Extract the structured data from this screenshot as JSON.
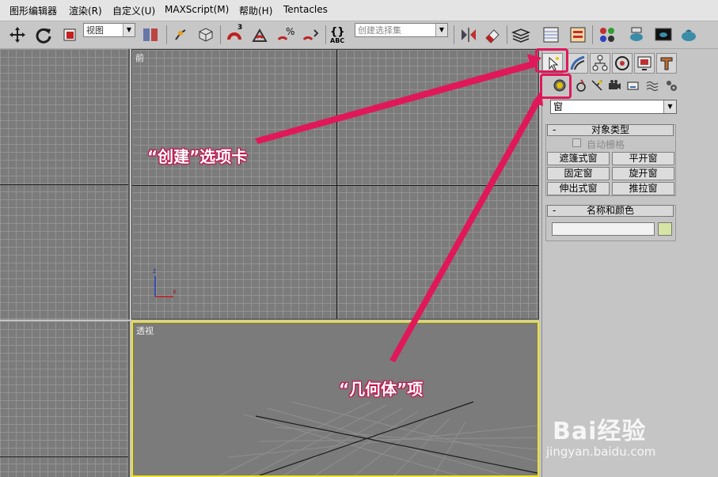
{
  "menu": [
    "图形编辑器",
    "渲染(R)",
    "自定义(U)",
    "MAXScript(M)",
    "帮助(H)",
    "Tentacles"
  ],
  "toolbar": {
    "view_combo": "视图",
    "selection_set_placeholder": "创建选择集",
    "snap_label": "3",
    "abc_label": "ABC"
  },
  "viewports": {
    "front_label": "前",
    "perspective_label": "透视",
    "axis_z": "z",
    "axis_x": "x"
  },
  "command_panel": {
    "object_category": "窗",
    "object_type_title": "对象类型",
    "auto_grid_label": "自动栅格",
    "object_buttons": [
      "遮篷式窗",
      "平开窗",
      "固定窗",
      "旋开窗",
      "伸出式窗",
      "推拉窗"
    ],
    "name_color_title": "名称和颜色",
    "name_value": "",
    "color_swatch": "#d6e4a4"
  },
  "annotations": {
    "create_tab_callout": "“创建”选项卡",
    "geometry_callout": "“几何体”项",
    "highlight_color": "#e0185a"
  },
  "watermark": {
    "brand": "Bai经验",
    "url": "jingyan.baidu.com"
  }
}
